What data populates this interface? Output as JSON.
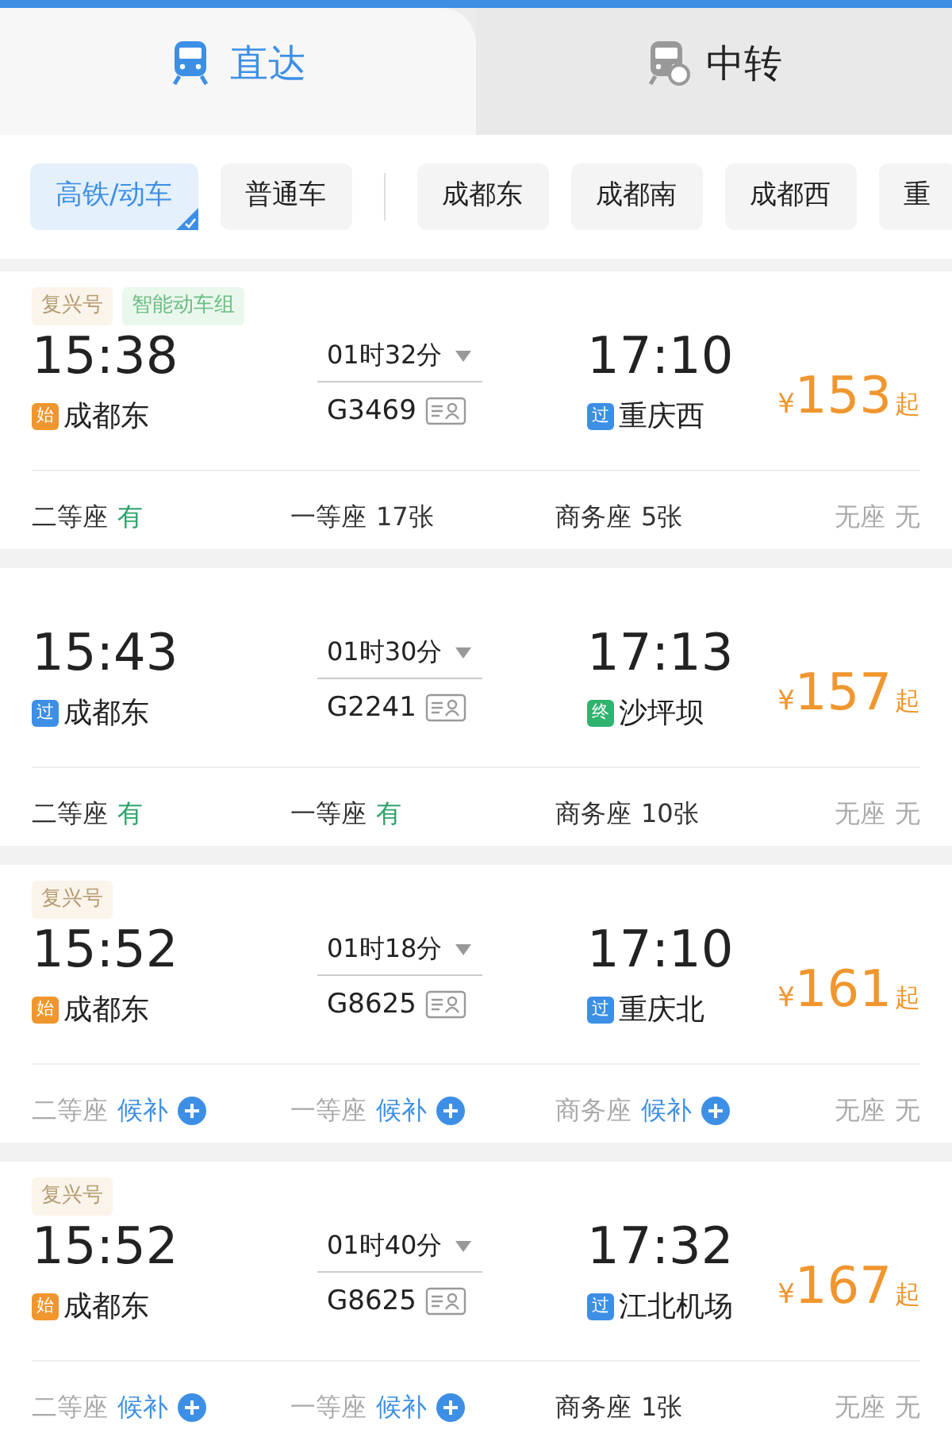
{
  "tabs": [
    {
      "label": "直达",
      "kind": "direct",
      "selected": true
    },
    {
      "label": "中转",
      "kind": "transfer",
      "selected": false
    }
  ],
  "filters": {
    "train_types": [
      {
        "label": "高铁/动车",
        "selected": true
      },
      {
        "label": "普通车",
        "selected": false
      }
    ],
    "stations": [
      {
        "label": "成都东",
        "selected": false
      },
      {
        "label": "成都南",
        "selected": false
      },
      {
        "label": "成都西",
        "selected": false
      },
      {
        "label": "重",
        "selected": false
      }
    ]
  },
  "trains": [
    {
      "tags": [
        {
          "label": "复兴号",
          "kind": "brand"
        },
        {
          "label": "智能动车组",
          "kind": "smart"
        }
      ],
      "depart": "15:38",
      "from_mark": {
        "label": "始",
        "kind": "start"
      },
      "from": "成都东",
      "duration": "01时32分",
      "number": "G3469",
      "arrive": "17:10",
      "to_mark": {
        "label": "过",
        "kind": "pass"
      },
      "to": "重庆西",
      "currency": "¥",
      "price": "153",
      "price_suffix": "起",
      "seats": [
        {
          "class": "二等座",
          "availability": "有",
          "kind": "yes"
        },
        {
          "class": "一等座",
          "availability": "17张",
          "kind": "count"
        },
        {
          "class": "商务座",
          "availability": "5张",
          "kind": "count"
        },
        {
          "class": "无座",
          "availability": "无",
          "kind": "none"
        }
      ]
    },
    {
      "depart": "15:43",
      "from_mark": {
        "label": "过",
        "kind": "pass"
      },
      "from": "成都东",
      "duration": "01时30分",
      "number": "G2241",
      "arrive": "17:13",
      "to_mark": {
        "label": "终",
        "kind": "end"
      },
      "to": "沙坪坝",
      "currency": "¥",
      "price": "157",
      "price_suffix": "起",
      "seats": [
        {
          "class": "二等座",
          "availability": "有",
          "kind": "yes"
        },
        {
          "class": "一等座",
          "availability": "有",
          "kind": "yes"
        },
        {
          "class": "商务座",
          "availability": "10张",
          "kind": "count"
        },
        {
          "class": "无座",
          "availability": "无",
          "kind": "none"
        }
      ]
    },
    {
      "tags": [
        {
          "label": "复兴号",
          "kind": "brand"
        }
      ],
      "depart": "15:52",
      "from_mark": {
        "label": "始",
        "kind": "start"
      },
      "from": "成都东",
      "duration": "01时18分",
      "number": "G8625",
      "arrive": "17:10",
      "to_mark": {
        "label": "过",
        "kind": "pass"
      },
      "to": "重庆北",
      "currency": "¥",
      "price": "161",
      "price_suffix": "起",
      "seats": [
        {
          "class": "二等座",
          "availability": "候补",
          "kind": "waitlist"
        },
        {
          "class": "一等座",
          "availability": "候补",
          "kind": "waitlist"
        },
        {
          "class": "商务座",
          "availability": "候补",
          "kind": "waitlist"
        },
        {
          "class": "无座",
          "availability": "无",
          "kind": "none"
        }
      ]
    },
    {
      "tags": [
        {
          "label": "复兴号",
          "kind": "brand"
        }
      ],
      "depart": "15:52",
      "from_mark": {
        "label": "始",
        "kind": "start"
      },
      "from": "成都东",
      "duration": "01时40分",
      "number": "G8625",
      "arrive": "17:32",
      "to_mark": {
        "label": "过",
        "kind": "pass"
      },
      "to": "江北机场",
      "currency": "¥",
      "price": "167",
      "price_suffix": "起",
      "seats": [
        {
          "class": "二等座",
          "availability": "候补",
          "kind": "waitlist"
        },
        {
          "class": "一等座",
          "availability": "候补",
          "kind": "waitlist"
        },
        {
          "class": "商务座",
          "availability": "1张",
          "kind": "count"
        },
        {
          "class": "无座",
          "availability": "无",
          "kind": "none"
        }
      ]
    }
  ]
}
